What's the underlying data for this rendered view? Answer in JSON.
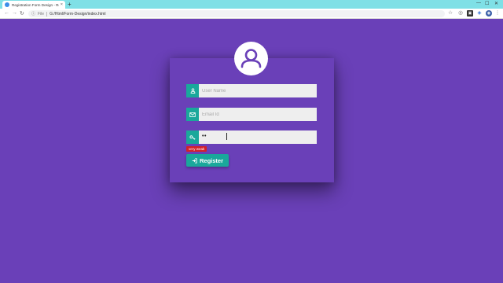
{
  "browser": {
    "tab_title": "Registration Form Design - Resp",
    "tab_close": "×",
    "new_tab": "+",
    "url_scheme": "File",
    "url": "G:/Html/Form-Design/index.html"
  },
  "form": {
    "username_placeholder": "User Name",
    "email_placeholder": "Email Id",
    "password_value": "••",
    "strength_label": "very weak",
    "register_label": "Register"
  },
  "colors": {
    "background": "#6a40b8",
    "accent": "#1aa89b",
    "input_bg": "#eeeeee",
    "weak_badge": "#d32029"
  }
}
